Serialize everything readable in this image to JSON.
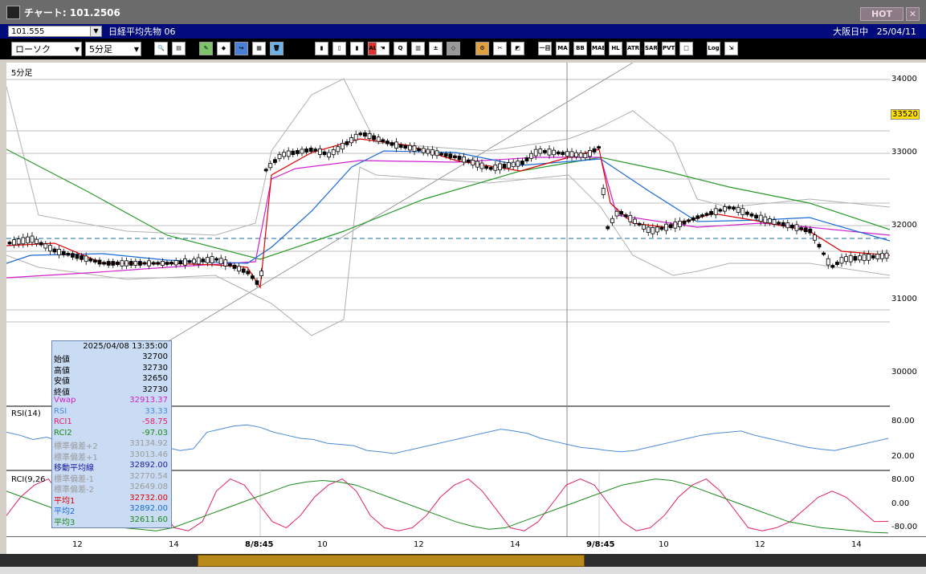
{
  "window": {
    "title": "チャート: 101.2506",
    "hot_label": "HOT",
    "close_label": "✕"
  },
  "header": {
    "code": "101.555",
    "instrument": "日経平均先物 06",
    "session": "大阪日中",
    "date": "25/04/11"
  },
  "toolbar": {
    "chart_type": "ローソク",
    "interval": "5分足",
    "buttons": [
      {
        "name": "zoom-button",
        "glyph": "🔍",
        "bg": "#ffffff"
      },
      {
        "name": "layout-button",
        "glyph": "▤",
        "bg": "#ffffff"
      },
      {
        "name": "draw-pen-button",
        "glyph": "✎",
        "bg": "#7dc46a"
      },
      {
        "name": "eraser-button",
        "glyph": "◆",
        "bg": "#ffffff"
      },
      {
        "name": "redo-button",
        "glyph": "↪",
        "bg": "#4a7fd6"
      },
      {
        "name": "notes-button",
        "glyph": "▦",
        "bg": "#ffffff"
      },
      {
        "name": "trash-button",
        "glyph": "🗑",
        "bg": "#6fb2e6"
      },
      {
        "name": "candle-a-button",
        "glyph": "▮",
        "bg": "#ffffff"
      },
      {
        "name": "candle-b-button",
        "glyph": "▯",
        "bg": "#ffffff"
      },
      {
        "name": "candle-c-button",
        "glyph": "▮",
        "bg": "#ffffff"
      },
      {
        "name": "all-button",
        "glyph": "ALL",
        "bg": "#e03030"
      },
      {
        "name": "hand-button",
        "glyph": "☚",
        "bg": "#ffffff"
      },
      {
        "name": "magnify-button",
        "glyph": "Q",
        "bg": "#ffffff"
      },
      {
        "name": "ma-color-button",
        "glyph": "▥",
        "bg": "#ffffff"
      },
      {
        "name": "tick-button",
        "glyph": "±",
        "bg": "#ffffff"
      },
      {
        "name": "disabled-button",
        "glyph": "◇",
        "bg": "#999999"
      },
      {
        "name": "settings-button",
        "glyph": "⚙",
        "bg": "#e0a040"
      },
      {
        "name": "tools-button",
        "glyph": "✂",
        "bg": "#ffffff"
      },
      {
        "name": "palette-button",
        "glyph": "◩",
        "bg": "#ffffff"
      },
      {
        "name": "indicator-ichimoku-button",
        "glyph": "一目",
        "bg": "#ffffff"
      },
      {
        "name": "indicator-ma-button",
        "glyph": "MA",
        "bg": "#ffffff"
      },
      {
        "name": "indicator-bb-button",
        "glyph": "BB",
        "bg": "#ffffff"
      },
      {
        "name": "indicator-mae-button",
        "glyph": "MAE",
        "bg": "#ffffff"
      },
      {
        "name": "indicator-hl-button",
        "glyph": "HL",
        "bg": "#ffffff"
      },
      {
        "name": "indicator-atr-button",
        "glyph": "ATR",
        "bg": "#ffffff"
      },
      {
        "name": "indicator-sar-button",
        "glyph": "SAR",
        "bg": "#ffffff"
      },
      {
        "name": "indicator-pvt-button",
        "glyph": "PVT",
        "bg": "#ffffff"
      },
      {
        "name": "indicator-box-button",
        "glyph": "□",
        "bg": "#ffffff"
      },
      {
        "name": "log-button",
        "glyph": "Log",
        "bg": "#ffffff"
      },
      {
        "name": "export-button",
        "glyph": "⇲",
        "bg": "#ffffff"
      }
    ]
  },
  "panel_labels": {
    "main": "5分足",
    "rsi": "RSI(14)",
    "rci": "RCI(9,26"
  },
  "price_axis": {
    "ticks": [
      "34000",
      "33000",
      "32000",
      "31000",
      "30000"
    ],
    "current": "33520"
  },
  "rsi_axis": {
    "ticks": [
      "80.00",
      "20.00"
    ]
  },
  "rci_axis": {
    "ticks": [
      "80.00",
      "0.00",
      "-80.00"
    ]
  },
  "time_axis": {
    "ticks": [
      "12",
      "14",
      "8/8:45",
      "10",
      "12",
      "14",
      "9/8:45",
      "10",
      "12",
      "14"
    ]
  },
  "info_panel": {
    "datetime": "2025/04/08 13:35:00",
    "rows": [
      {
        "label": "始値",
        "value": "32700",
        "color": "#000000"
      },
      {
        "label": "高値",
        "value": "32730",
        "color": "#000000"
      },
      {
        "label": "安値",
        "value": "32650",
        "color": "#000000"
      },
      {
        "label": "終値",
        "value": "32730",
        "color": "#000000"
      },
      {
        "label": "Vwap",
        "value": "32913.37",
        "color": "#d020d0"
      },
      {
        "label": "RSI",
        "value": "33.33",
        "color": "#4a8ad8"
      },
      {
        "label": "RCI1",
        "value": "-58.75",
        "color": "#e0206a"
      },
      {
        "label": "RCI2",
        "value": "-97.03",
        "color": "#1a8a1a"
      },
      {
        "label": "標準偏差+2",
        "value": "33134.92",
        "color": "#9a9a9a"
      },
      {
        "label": "標準偏差+1",
        "value": "33013.46",
        "color": "#9a9a9a"
      },
      {
        "label": "移動平均線",
        "value": "32892.00",
        "color": "#1a1aa0"
      },
      {
        "label": "標準偏差-1",
        "value": "32770.54",
        "color": "#9a9a9a"
      },
      {
        "label": "標準偏差-2",
        "value": "32649.08",
        "color": "#9a9a9a"
      },
      {
        "label": "平均1",
        "value": "32732.00",
        "color": "#e00000"
      },
      {
        "label": "平均2",
        "value": "32892.00",
        "color": "#1a6ad8"
      },
      {
        "label": "平均3",
        "value": "32611.60",
        "color": "#1a8a1a"
      }
    ]
  },
  "colors": {
    "candle_up": "#ffffff",
    "candle_down": "#000000",
    "ma_red": "#e00000",
    "ma_blue": "#1a6ad8",
    "ma_green": "#2a9a2a",
    "vwap": "#d020d0",
    "bands": "#b0b0b0",
    "rsi": "#4a8ad8",
    "rci1": "#e0206a",
    "rci2": "#1a8a1a"
  },
  "chart_data": {
    "type": "line",
    "series": [
      {
        "name": "RSI",
        "values": [
          60,
          55,
          48,
          52,
          45,
          50,
          47,
          55,
          50,
          45,
          40,
          38,
          35,
          30,
          33,
          60,
          65,
          70,
          72,
          68,
          60,
          55,
          50,
          48,
          42,
          40,
          38,
          30,
          28,
          25,
          30,
          35,
          40,
          45,
          50,
          55,
          60,
          65,
          62,
          58,
          50,
          45,
          40,
          35,
          33,
          30,
          28,
          30,
          35,
          40,
          45,
          50,
          55,
          58,
          60,
          62,
          55,
          50,
          45,
          40,
          35,
          32,
          30,
          35,
          40,
          45,
          50
        ]
      },
      {
        "name": "RCI1",
        "values": [
          -40,
          20,
          60,
          80,
          20,
          -60,
          -80,
          -20,
          40,
          80,
          60,
          -20,
          -80,
          -90,
          -60,
          40,
          80,
          60,
          0,
          -60,
          -80,
          -40,
          20,
          60,
          80,
          40,
          -40,
          -80,
          -90,
          -80,
          -40,
          20,
          60,
          80,
          40,
          -20,
          -80,
          -90,
          -60,
          0,
          60,
          80,
          60,
          0,
          -60,
          -90,
          -80,
          -40,
          20,
          60,
          80,
          40,
          -20,
          -80,
          -90,
          -80,
          -60,
          -20,
          20,
          40,
          20,
          -20,
          -60,
          -58.75
        ]
      },
      {
        "name": "RCI2",
        "values": [
          40,
          20,
          0,
          -20,
          -40,
          -60,
          -70,
          -80,
          -85,
          -90,
          -80,
          -60,
          -40,
          -20,
          0,
          20,
          40,
          60,
          70,
          75,
          70,
          60,
          40,
          20,
          0,
          -20,
          -40,
          -60,
          -75,
          -85,
          -80,
          -60,
          -40,
          -20,
          0,
          20,
          40,
          60,
          70,
          80,
          75,
          60,
          40,
          20,
          0,
          -20,
          -40,
          -60,
          -70,
          -80,
          -85,
          -90,
          -95,
          -97.03
        ]
      }
    ],
    "title": "",
    "xlabel": "",
    "ylabel": ""
  }
}
